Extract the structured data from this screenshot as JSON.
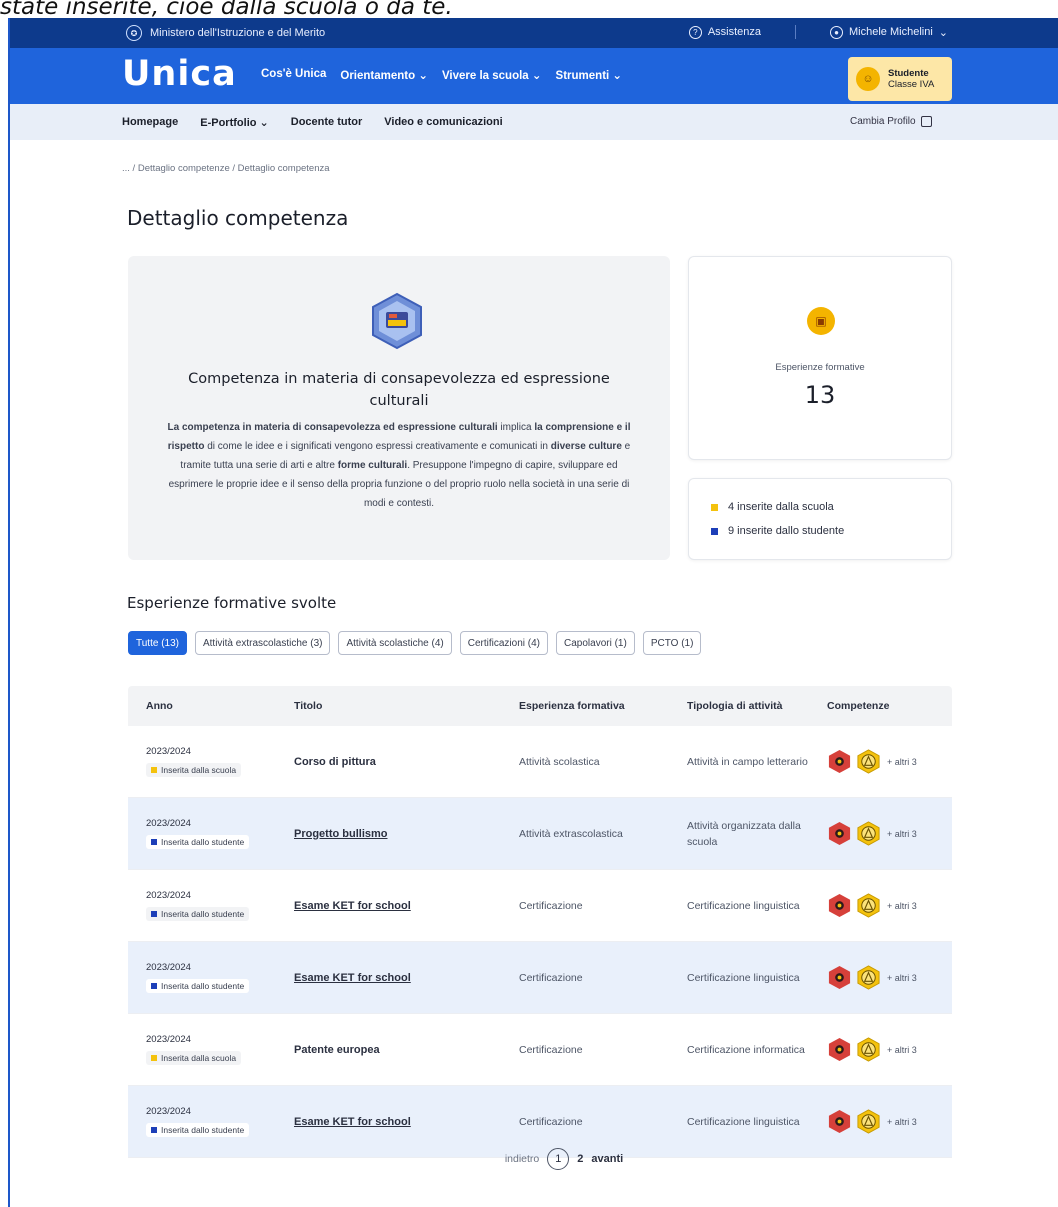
{
  "caption": "state inserite, cioè dalla scuola o da te.",
  "ministry": {
    "name": "Ministero dell'Istruzione e del Merito",
    "assistance": "Assistenza",
    "user": "Michele Michelini",
    "user_chevron": "⌄"
  },
  "nav": {
    "brand": "Unica",
    "links": [
      "Cos'è Unica",
      "Orientamento ⌄",
      "Vivere la scuola ⌄",
      "Strumenti ⌄"
    ],
    "profile_role": "Studente",
    "profile_class": "Classe IVA"
  },
  "subnav": {
    "links": [
      "Homepage",
      "E-Portfolio ⌄",
      "Docente tutor",
      "Video e comunicazioni"
    ],
    "change_profile": "Cambia Profilo"
  },
  "breadcrumb": "... / Dettaglio competenze / Dettaglio competenza",
  "page_title": "Dettaglio competenza",
  "competence": {
    "title": "Competenza in materia di consapevolezza ed espressione culturali",
    "desc_parts": [
      {
        "text": "La competenza in materia di consapevolezza ed espressione culturali",
        "bold": true
      },
      {
        "text": " implica ",
        "bold": false
      },
      {
        "text": "la comprensione e il rispetto",
        "bold": true
      },
      {
        "text": " di come le idee e i significati vengono espressi creativamente e comunicati in ",
        "bold": false
      },
      {
        "text": "diverse culture",
        "bold": true
      },
      {
        "text": " e tramite tutta una serie di arti e altre ",
        "bold": false
      },
      {
        "text": "forme culturali",
        "bold": true
      },
      {
        "text": ". Presuppone l'impegno di capire, sviluppare ed esprimere le proprie idee e il senso della propria funzione o del proprio ruolo nella società in una serie di modi e contesti.",
        "bold": false
      }
    ]
  },
  "stats": {
    "label": "Esperienze formative",
    "value": "13"
  },
  "legend": {
    "school": {
      "text": "4 inserite dalla scuola",
      "color": "#f4c20d"
    },
    "student": {
      "text": "9 inserite dallo studente",
      "color": "#1d3fb8"
    }
  },
  "section_title": "Esperienze formative svolte",
  "filters": [
    "Tutte (13)",
    "Attività extrascolastiche (3)",
    "Attività scolastiche (4)",
    "Certificazioni (4)",
    "Capolavori (1)",
    "PCTO (1)"
  ],
  "table": {
    "headers": [
      "Anno",
      "Titolo",
      "Esperienza formativa",
      "Tipologia di attività",
      "Competenze"
    ],
    "more_label": "+ altri 3",
    "rows": [
      {
        "year": "2023/2024",
        "source": "Inserita dalla scuola",
        "source_color": "#f4c20d",
        "title": "Corso di pittura",
        "underline": false,
        "experience": "Attività scolastica",
        "type": "Attività in campo letterario"
      },
      {
        "year": "2023/2024",
        "source": "Inserita dallo studente",
        "source_color": "#1d3fb8",
        "title": "Progetto bullismo",
        "underline": true,
        "experience": "Attività extrascolastica",
        "type": "Attività organizzata dalla scuola"
      },
      {
        "year": "2023/2024",
        "source": "Inserita dallo studente",
        "source_color": "#1d3fb8",
        "title": "Esame KET for school",
        "underline": true,
        "experience": "Certificazione",
        "type": "Certificazione linguistica"
      },
      {
        "year": "2023/2024",
        "source": "Inserita dallo studente",
        "source_color": "#1d3fb8",
        "title": "Esame KET for school",
        "underline": true,
        "experience": "Certificazione",
        "type": "Certificazione linguistica"
      },
      {
        "year": "2023/2024",
        "source": "Inserita dalla scuola",
        "source_color": "#f4c20d",
        "title": "Patente europea",
        "underline": false,
        "experience": "Certificazione",
        "type": "Certificazione informatica"
      },
      {
        "year": "2023/2024",
        "source": "Inserita dallo studente",
        "source_color": "#1d3fb8",
        "title": "Esame KET for school",
        "underline": true,
        "experience": "Certificazione",
        "type": "Certificazione linguistica"
      }
    ]
  },
  "pager": {
    "prev": "indietro",
    "current": "1",
    "next_page": "2",
    "next": "avanti"
  },
  "colors": {
    "primary": "#1f64dc",
    "ministry_bar": "#0d3a8c",
    "school_yellow": "#f4c20d",
    "student_blue": "#1d3fb8",
    "row_highlight": "#e9f0fb"
  }
}
